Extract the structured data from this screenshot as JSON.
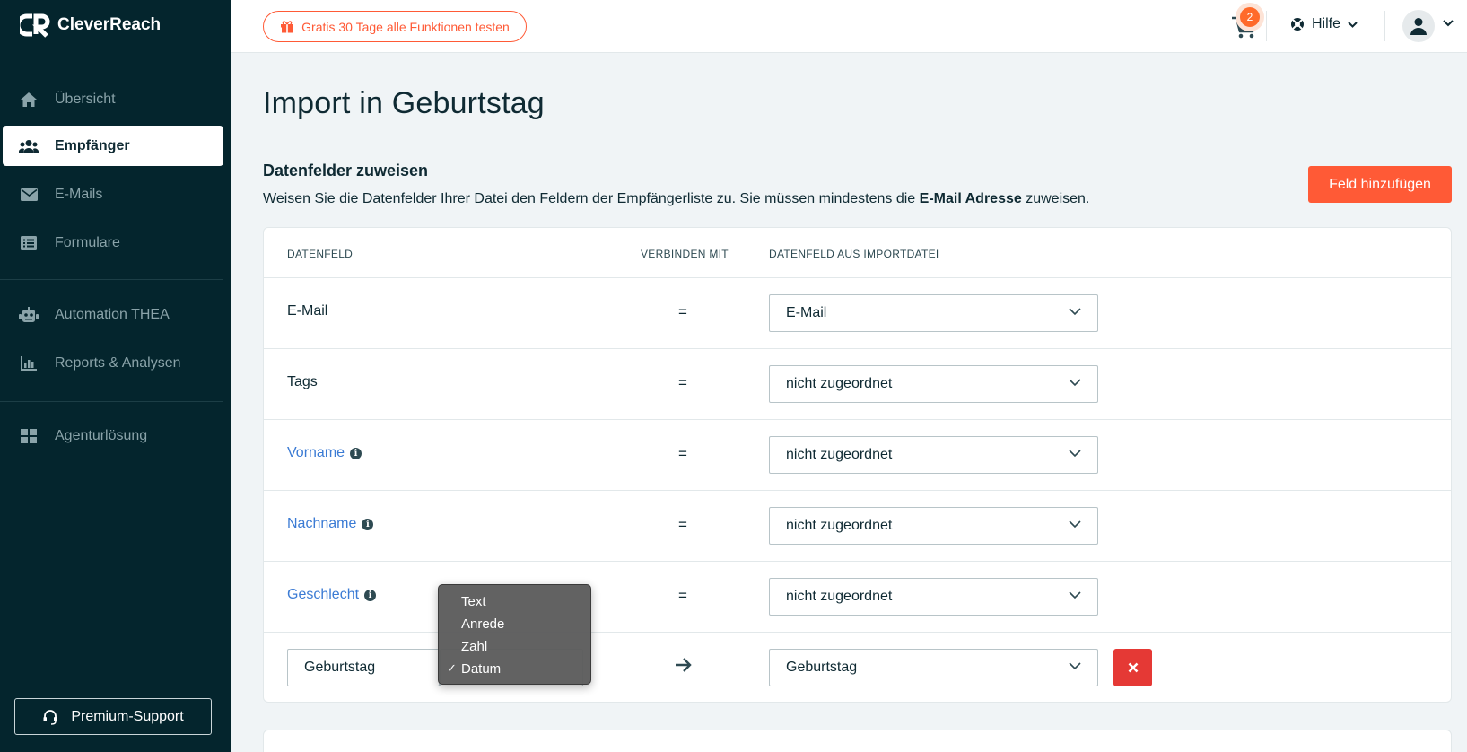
{
  "app": {
    "brand": "CleverReach"
  },
  "sidebar": {
    "items": [
      {
        "label": "Übersicht",
        "icon": "home-icon"
      },
      {
        "label": "Empfänger",
        "icon": "users-icon",
        "active": true
      },
      {
        "label": "E-Mails",
        "icon": "envelope-icon"
      },
      {
        "label": "Formulare",
        "icon": "form-icon"
      },
      {
        "label": "Automation THEA",
        "icon": "robot-icon"
      },
      {
        "label": "Reports & Analysen",
        "icon": "bar-chart-icon"
      },
      {
        "label": "Agenturlösung",
        "icon": "grid-icon"
      }
    ],
    "support_label": "Premium-Support"
  },
  "topbar": {
    "trial_label": "Gratis 30 Tage alle Funktionen testen",
    "cart_count": "2",
    "help_label": "Hilfe"
  },
  "main": {
    "title": "Import in Geburtstag",
    "section_title": "Datenfelder zuweisen",
    "desc_before": "Weisen Sie die Datenfelder Ihrer Datei den Feldern der Empfängerliste zu. Sie müssen mindestens die ",
    "desc_bold": "E-Mail Adresse",
    "desc_after": " zuweisen.",
    "add_field_label": "Feld hinzufügen"
  },
  "table": {
    "headers": {
      "field": "DATENFELD",
      "connect": "VERBINDEN MIT",
      "import_field": "DATENFELD AUS IMPORTDATEI"
    },
    "rows": [
      {
        "label": "E-Mail",
        "link": false,
        "info": false,
        "op": "=",
        "value": "E-Mail"
      },
      {
        "label": "Tags",
        "link": false,
        "info": false,
        "op": "=",
        "value": "nicht zugeordnet"
      },
      {
        "label": "Vorname",
        "link": true,
        "info": true,
        "op": "=",
        "value": "nicht zugeordnet"
      },
      {
        "label": "Nachname",
        "link": true,
        "info": true,
        "op": "=",
        "value": "nicht zugeordnet"
      },
      {
        "label": "Geschlecht",
        "link": true,
        "info": true,
        "op": "=",
        "value": "nicht zugeordnet"
      }
    ],
    "new_row": {
      "name_value": "Geburtstag",
      "import_value": "Geburtstag"
    }
  },
  "type_menu": {
    "options": [
      "Text",
      "Anrede",
      "Zahl",
      "Datum"
    ],
    "selected": "Datum"
  },
  "colors": {
    "sidebar_bg": "#04252d",
    "accent": "#ff5a36",
    "link": "#3b7bd4",
    "danger": "#e53935"
  }
}
